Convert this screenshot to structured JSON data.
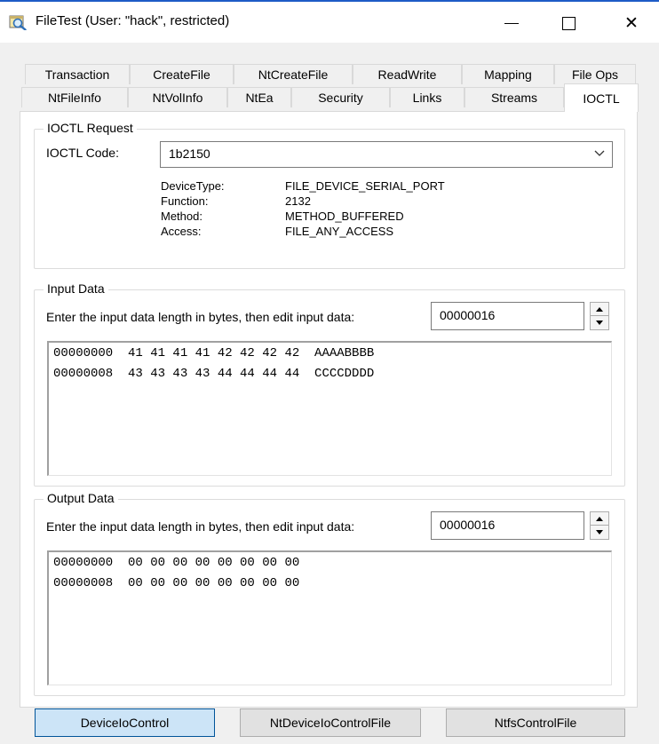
{
  "window": {
    "title": "FileTest (User: \"hack\", restricted)",
    "close_glyph": "✕"
  },
  "tabs": {
    "row1": [
      "Transaction",
      "CreateFile",
      "NtCreateFile",
      "ReadWrite",
      "Mapping",
      "File Ops"
    ],
    "row2": [
      "NtFileInfo",
      "NtVolInfo",
      "NtEa",
      "Security",
      "Links",
      "Streams",
      "IOCTL"
    ],
    "active": "IOCTL"
  },
  "ioctl_request": {
    "group_title": "IOCTL Request",
    "code_label": "IOCTL Code:",
    "code_value": "1b2150",
    "details": [
      {
        "key": "DeviceType:",
        "value": "FILE_DEVICE_SERIAL_PORT"
      },
      {
        "key": "Function:",
        "value": "2132"
      },
      {
        "key": "Method:",
        "value": "METHOD_BUFFERED"
      },
      {
        "key": "Access:",
        "value": "FILE_ANY_ACCESS"
      }
    ]
  },
  "input_data": {
    "group_title": "Input Data",
    "prompt": "Enter the input data length in bytes, then edit input data:",
    "length": "00000016",
    "lines": [
      "00000000  41 41 41 41 42 42 42 42  AAAABBBB",
      "00000008  43 43 43 43 44 44 44 44  CCCCDDDD"
    ]
  },
  "output_data": {
    "group_title": "Output Data",
    "prompt": "Enter the input data length in bytes, then edit input data:",
    "length": "00000016",
    "lines": [
      "00000000  00 00 00 00 00 00 00 00",
      "00000008  00 00 00 00 00 00 00 00"
    ]
  },
  "buttons": {
    "device_io_control": "DeviceIoControl",
    "nt_device_io_control_file": "NtDeviceIoControlFile",
    "ntfs_control_file": "NtfsControlFile"
  },
  "colors": {
    "accent": "#1e5bc6",
    "dialog_bg": "#f0f0f0",
    "default_button": "#cce4f7"
  },
  "icons": [
    "app-icon",
    "minimize-icon",
    "maximize-icon",
    "close-icon",
    "chevron-down-icon",
    "spin-up-icon",
    "spin-down-icon"
  ]
}
